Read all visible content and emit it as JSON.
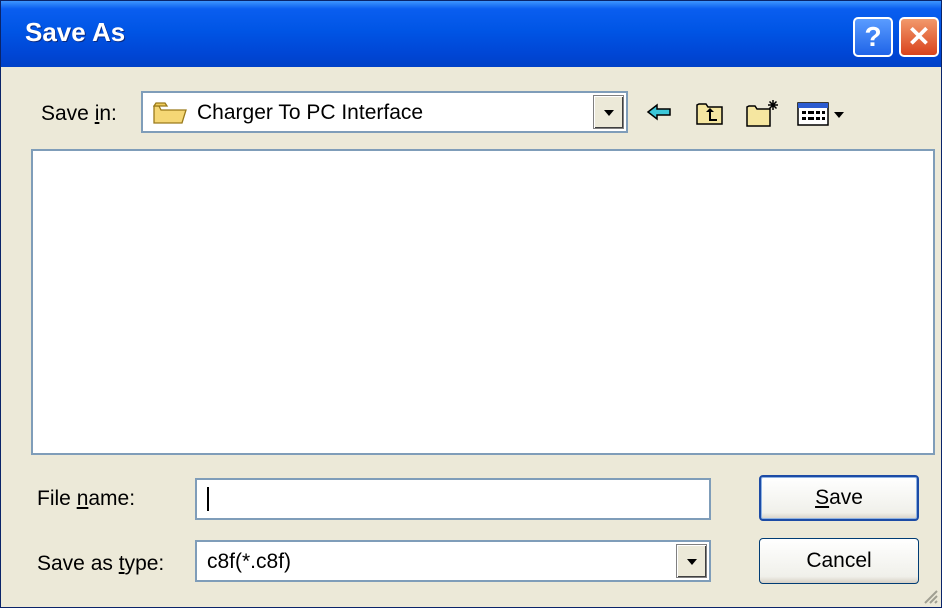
{
  "window": {
    "title": "Save As"
  },
  "titlebar": {
    "help_glyph": "?",
    "close_glyph": "✕"
  },
  "save_in": {
    "label_prefix": "Save ",
    "label_accel": "i",
    "label_suffix": "n:",
    "value": "Charger To PC Interface",
    "icon": "folder-icon"
  },
  "toolbar": {
    "icons": [
      "back-arrow-icon",
      "up-one-level-icon",
      "create-new-folder-icon",
      "view-menu-icon"
    ]
  },
  "file_name": {
    "label_prefix": "File ",
    "label_accel": "n",
    "label_suffix": "ame:",
    "value": ""
  },
  "save_as_type": {
    "label_prefix": "Save as ",
    "label_accel": "t",
    "label_suffix": "ype:",
    "value": "c8f(*.c8f)"
  },
  "buttons": {
    "save_accel": "S",
    "save_rest": "ave",
    "cancel": "Cancel"
  },
  "colors": {
    "titlebar": "#0055e5",
    "dialog_bg": "#ece9d8",
    "field_border": "#7f9db9",
    "close_button": "#d9431d"
  }
}
